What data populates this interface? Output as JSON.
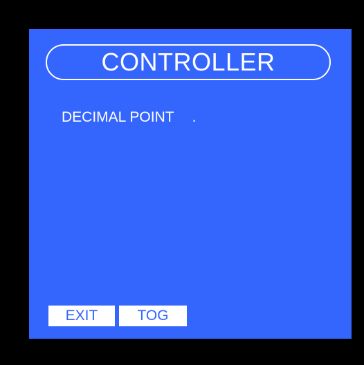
{
  "screen": {
    "title": "CONTROLLER",
    "colors": {
      "background": "#3465fd",
      "bezel": "#000000",
      "text": "#ffffff"
    }
  },
  "setting": {
    "label": "DECIMAL POINT",
    "value": "."
  },
  "softkeys": {
    "exit_label": "EXIT",
    "tog_label": "TOG"
  }
}
